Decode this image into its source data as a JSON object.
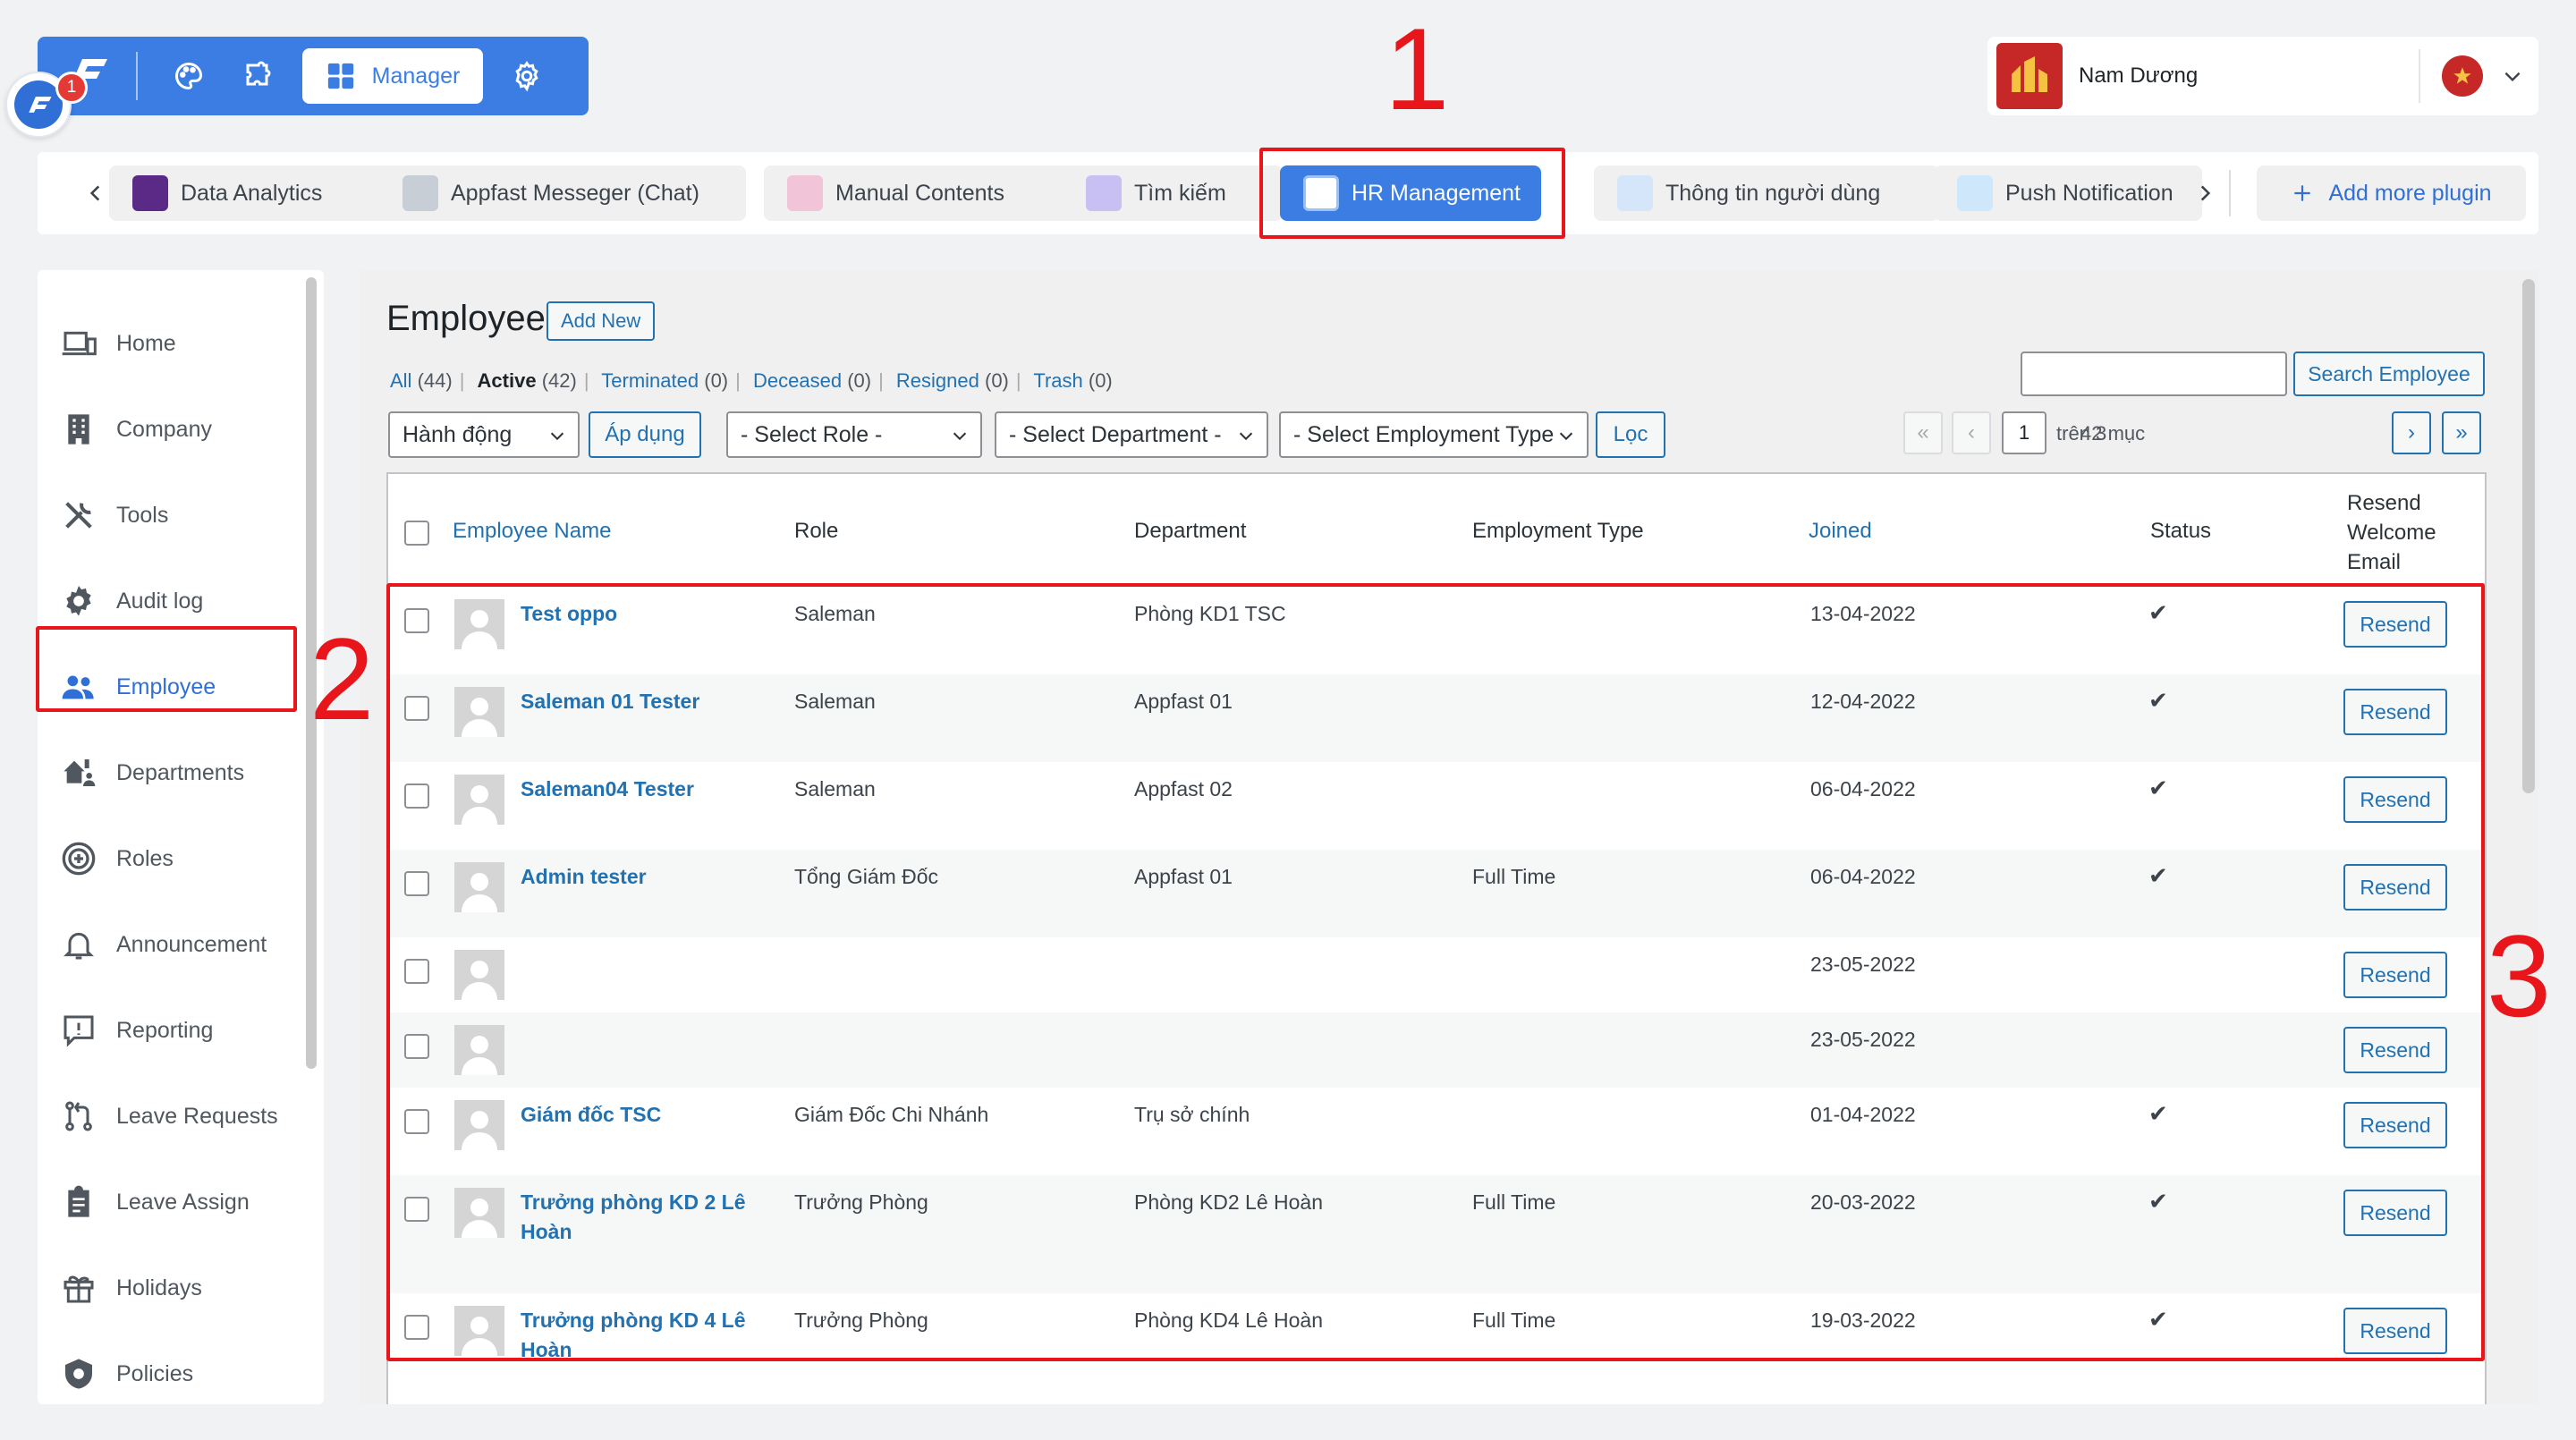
{
  "topbar": {
    "chat_badge": "1",
    "manager_label": "Manager"
  },
  "user": {
    "name": "Nam Dương"
  },
  "plugins": {
    "tabs": [
      {
        "label": "Data Analytics",
        "color": "#5b2a86"
      },
      {
        "label": "Appfast Messeger (Chat)",
        "color": "#9aa4b0"
      },
      {
        "label": "Manual Contents",
        "color": "#e9a0c2"
      },
      {
        "label": "Tìm kiếm",
        "color": "#7b5bd6"
      },
      {
        "label": "HR Management",
        "color": "#ffffff"
      },
      {
        "label": "Thông tin người dùng",
        "color": "#9ec3f0"
      },
      {
        "label": "Push Notification",
        "color": "#8fc6f2"
      }
    ],
    "add_label": "Add more plugin"
  },
  "sidebar": {
    "items": [
      {
        "label": "Home",
        "icon": "devices-icon"
      },
      {
        "label": "Company",
        "icon": "building-icon"
      },
      {
        "label": "Tools",
        "icon": "tools-icon"
      },
      {
        "label": "Audit log",
        "icon": "gear-icon"
      },
      {
        "label": "Employee",
        "icon": "users-icon"
      },
      {
        "label": "Departments",
        "icon": "departments-icon"
      },
      {
        "label": "Roles",
        "icon": "plus-circle-icon"
      },
      {
        "label": "Announcement",
        "icon": "bell-icon"
      },
      {
        "label": "Reporting",
        "icon": "report-icon"
      },
      {
        "label": "Leave Requests",
        "icon": "pull-request-icon"
      },
      {
        "label": "Leave Assign",
        "icon": "clipboard-icon"
      },
      {
        "label": "Holidays",
        "icon": "gift-icon"
      },
      {
        "label": "Policies",
        "icon": "shield-icon"
      }
    ]
  },
  "main": {
    "title": "Employee",
    "add_new": "Add New",
    "status": {
      "all_label": "All",
      "all_count": "(44)",
      "active_label": "Active",
      "active_count": "(42)",
      "terminated_label": "Terminated",
      "terminated_count": "(0)",
      "deceased_label": "Deceased",
      "deceased_count": "(0)",
      "resigned_label": "Resigned",
      "resigned_count": "(0)",
      "trash_label": "Trash",
      "trash_count": "(0)"
    },
    "filters": {
      "bulk_action": "Hành động",
      "apply": "Áp dụng",
      "role": "- Select Role -",
      "department": "- Select Department -",
      "employment_type": "- Select Employment Type -",
      "filter_button": "Lọc"
    },
    "search_button": "Search Employee",
    "pagination": {
      "items": "42 mục",
      "first": "«",
      "prev": "‹",
      "current": "1",
      "of": "trên 3",
      "next": "›",
      "last": "»"
    },
    "table": {
      "headers": {
        "name": "Employee Name",
        "role": "Role",
        "department": "Department",
        "employment_type": "Employment Type",
        "joined": "Joined",
        "status": "Status",
        "resend": [
          "Resend",
          "Welcome",
          "Email"
        ]
      },
      "resend_label": "Resend",
      "rows": [
        {
          "name": "Test oppo",
          "name2": "",
          "role": "Saleman",
          "department": "Phòng KD1 TSC",
          "type": "",
          "joined": "13-04-2022",
          "status": "✔"
        },
        {
          "name": "Saleman 01 Tester",
          "name2": "",
          "role": "Saleman",
          "department": "Appfast 01",
          "type": "",
          "joined": "12-04-2022",
          "status": "✔"
        },
        {
          "name": "Saleman04 Tester",
          "name2": "",
          "role": "Saleman",
          "department": "Appfast 02",
          "type": "",
          "joined": "06-04-2022",
          "status": "✔"
        },
        {
          "name": "Admin tester",
          "name2": "",
          "role": "Tổng Giám Đốc",
          "department": "Appfast 01",
          "type": "Full Time",
          "joined": "06-04-2022",
          "status": "✔"
        },
        {
          "name": "",
          "name2": "",
          "role": "",
          "department": "",
          "type": "",
          "joined": "23-05-2022",
          "status": ""
        },
        {
          "name": "",
          "name2": "",
          "role": "",
          "department": "",
          "type": "",
          "joined": "23-05-2022",
          "status": ""
        },
        {
          "name": "Giám đốc TSC",
          "name2": "",
          "role": "Giám Đốc Chi Nhánh",
          "department": "Trụ sở chính",
          "type": "",
          "joined": "01-04-2022",
          "status": "✔"
        },
        {
          "name": "Trưởng phòng KD 2 Lê",
          "name2": "Hoàn",
          "role": "Trưởng Phòng",
          "department": "Phòng KD2 Lê Hoàn",
          "type": "Full Time",
          "joined": "20-03-2022",
          "status": "✔"
        },
        {
          "name": "Trưởng phòng KD 4 Lê",
          "name2": "Hoàn",
          "role": "Trưởng Phòng",
          "department": "Phòng KD4 Lê Hoàn",
          "type": "Full Time",
          "joined": "19-03-2022",
          "status": "✔"
        }
      ]
    }
  },
  "annotations": {
    "n1": "1",
    "n2": "2",
    "n3": "3",
    "color": "#e8151b"
  }
}
